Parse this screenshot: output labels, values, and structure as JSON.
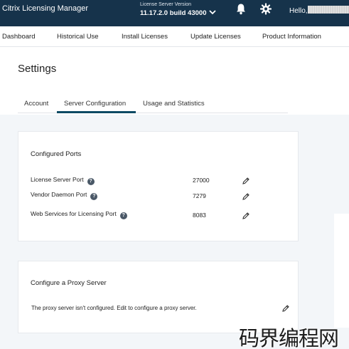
{
  "header": {
    "app_title": "Citrix Licensing Manager",
    "version_label": "License Server Version",
    "version_value": "11.17.2.0 build 43000",
    "hello": "Hello,",
    "icons": [
      "chevron-down-icon",
      "bell-icon",
      "gear-icon"
    ]
  },
  "nav": {
    "items": [
      {
        "label": "Dashboard"
      },
      {
        "label": "Historical Use"
      },
      {
        "label": "Install Licenses"
      },
      {
        "label": "Update Licenses"
      },
      {
        "label": "Product Information"
      }
    ]
  },
  "page": {
    "title": "Settings"
  },
  "tabs": {
    "items": [
      {
        "label": "Account"
      },
      {
        "label": "Server Configuration"
      },
      {
        "label": "Usage and Statistics"
      }
    ],
    "active": "Server Configuration"
  },
  "ports": {
    "title": "Configured Ports",
    "rows": [
      {
        "label": "License Server Port",
        "value": "27000"
      },
      {
        "label": "Vendor Daemon Port",
        "value": "7279"
      },
      {
        "label": "Web Services for Licensing Port",
        "value": "8083"
      }
    ]
  },
  "proxy": {
    "title": "Configure a Proxy Server",
    "text": "The proxy server isn't configured. Edit to configure a proxy server."
  },
  "watermark": {
    "text": "码界编程网"
  },
  "colors": {
    "header_bg": "#16334b",
    "tab_active": "#0d4a64",
    "content_bg": "#f3f6f9"
  }
}
